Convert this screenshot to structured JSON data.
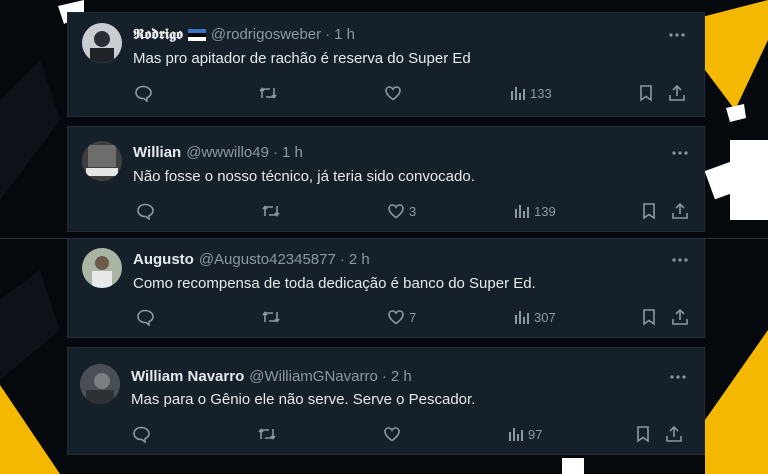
{
  "colors": {
    "card_background": "#15202b",
    "page_background": "#05080c",
    "accent_yellow": "#f5b800",
    "text_primary": "#e7e9ea",
    "text_secondary": "#8b98a5"
  },
  "tweets": [
    {
      "display_name": "𝕽𝖔𝖉𝖗𝖎𝖌𝖔",
      "flag": "estonia-flag",
      "handle": "@rodrigosweber",
      "separator": "·",
      "time": "1 h",
      "text": "Mas pro apitador de rachão é reserva do Super Ed",
      "replies": "",
      "retweets": "",
      "likes": "",
      "views": "133"
    },
    {
      "display_name": "Willian",
      "handle": "@wwwillo49",
      "separator": "·",
      "time": "1 h",
      "text": "Não fosse o nosso técnico, já teria sido convocado.",
      "replies": "",
      "retweets": "",
      "likes": "3",
      "views": "139"
    },
    {
      "display_name": "Augusto",
      "handle": "@Augusto42345877",
      "separator": "·",
      "time": "2 h",
      "text": "Como recompensa de toda dedicação é banco  do Super Ed.",
      "replies": "",
      "retweets": "",
      "likes": "7",
      "views": "307"
    },
    {
      "display_name": "William Navarro",
      "handle": "@WilliamGNavarro",
      "separator": "·",
      "time": "2 h",
      "text": "Mas para o Gênio ele não serve. Serve o Pescador.",
      "replies": "",
      "retweets": "",
      "likes": "",
      "views": "97"
    }
  ],
  "icons": {
    "reply": "reply-icon",
    "retweet": "retweet-icon",
    "like": "heart-icon",
    "views": "views-chart-icon",
    "bookmark": "bookmark-icon",
    "share": "share-icon",
    "more": "more-dots-icon"
  }
}
